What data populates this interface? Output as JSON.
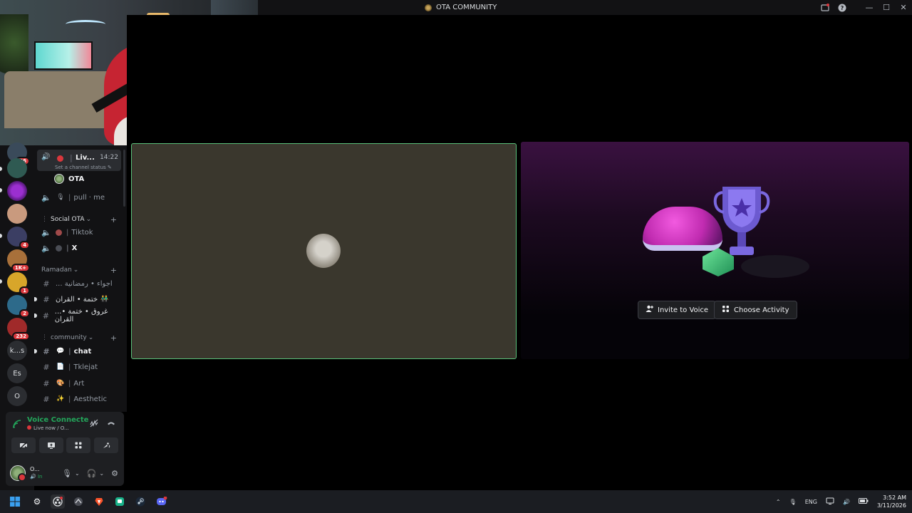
{
  "window": {
    "title": "OTA COMMUNITY",
    "title_bar_icons": [
      "inbox-icon",
      "help-icon"
    ],
    "controls": [
      "minimize",
      "maximize",
      "close"
    ]
  },
  "server_rail": {
    "items": [
      {
        "name": "server-1",
        "badge": "46"
      },
      {
        "name": "server-2",
        "badge": ""
      },
      {
        "name": "server-3",
        "badge": ""
      },
      {
        "name": "server-4",
        "badge": ""
      },
      {
        "name": "server-5",
        "badge": "4"
      },
      {
        "name": "server-6",
        "badge": "1K+"
      },
      {
        "name": "server-7",
        "badge": "1"
      },
      {
        "name": "server-8",
        "badge": "2"
      },
      {
        "name": "server-9",
        "badge": "232"
      },
      {
        "name": "server-ks",
        "label": "k...s",
        "badge": ""
      },
      {
        "name": "server-es",
        "label": "Es",
        "badge": ""
      },
      {
        "name": "server-o",
        "label": "O",
        "badge": ""
      }
    ]
  },
  "sidebar": {
    "live_channel": {
      "name": "Liv...",
      "time": "14:22",
      "status_placeholder": "Set a channel status"
    },
    "voice_user": "OTA",
    "voice_channels": [
      {
        "label": "pull · me"
      }
    ],
    "categories": {
      "social": "Social OTA",
      "ramadan": "Ramadan",
      "community": "community"
    },
    "social_channels": [
      {
        "label": "Tiktok"
      },
      {
        "label": "X"
      }
    ],
    "ramadan_channels": [
      {
        "label": "... اجواء • رمضانية"
      },
      {
        "label": "ختمة • القران"
      },
      {
        "label": "...غروق • ختمة • القران"
      }
    ],
    "community_channels": [
      {
        "label": "chat",
        "emoji": "💬",
        "active": true
      },
      {
        "label": "Tklejat",
        "emoji": "📄"
      },
      {
        "label": "Art",
        "emoji": "🎨"
      },
      {
        "label": "Aesthetic",
        "emoji": "✨"
      }
    ]
  },
  "voice_panel": {
    "status": "Voice Connecte",
    "sub": "Live now / O...",
    "user_name": "O...",
    "user_sub": "In"
  },
  "stage": {
    "invite_button": "Invite to Voice",
    "activity_button": "Choose Activity"
  },
  "taskbar": {
    "language": "ENG",
    "time": "3:52 AM",
    "date": "3/11/2026"
  },
  "colors": {
    "accent_green": "#23a55a",
    "badge_red": "#da373c",
    "tile_border": "#5ac07a"
  }
}
